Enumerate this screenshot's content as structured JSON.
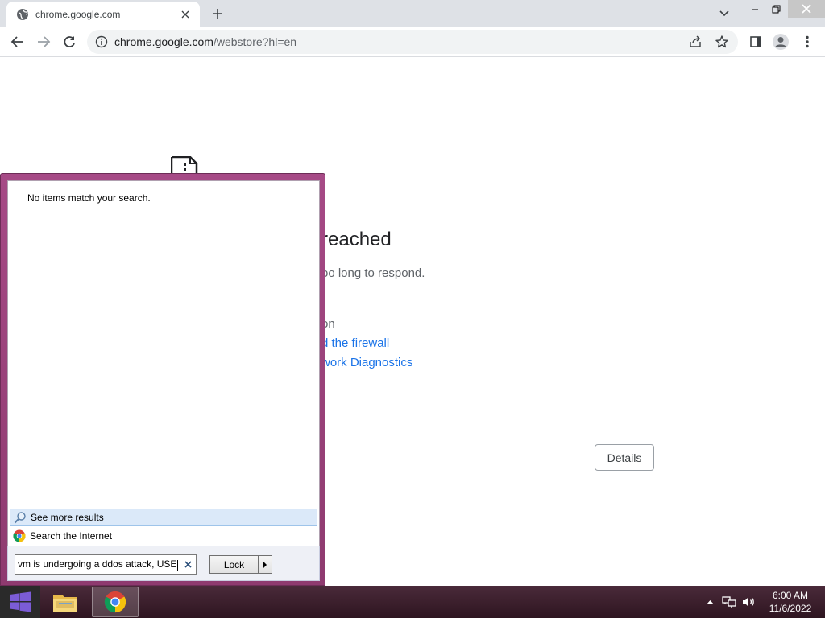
{
  "browser": {
    "tab": {
      "title": "chrome.google.com"
    },
    "omnibox": {
      "host": "chrome.google.com",
      "path": "/webstore?hl=en"
    }
  },
  "page": {
    "error_title": "reached",
    "error_desc": "oo long to respond.",
    "try_items": [
      {
        "text": "on",
        "link": false
      },
      {
        "text": "d the firewall",
        "link": true
      },
      {
        "text": "work Diagnostics",
        "link": true
      }
    ],
    "details_label": "Details"
  },
  "start_menu": {
    "no_items": "No items match your search.",
    "see_more": "See more results",
    "search_internet": "Search the Internet",
    "search_value": "vm is undergoing a ddos attack, USE",
    "lock_label": "Lock"
  },
  "taskbar": {
    "time": "6:00 AM",
    "date": "11/6/2022"
  },
  "colors": {
    "accent_link": "#1a73e8",
    "start_menu_frame": "#a64a86"
  }
}
